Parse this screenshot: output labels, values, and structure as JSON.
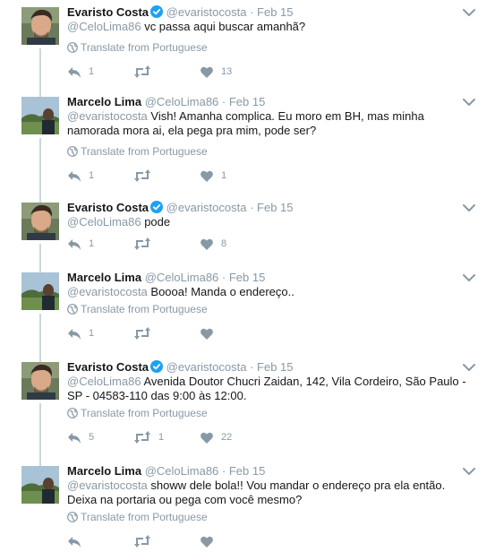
{
  "translate_label": "Translate from Portuguese",
  "colors": {
    "muted": "#8899a6",
    "verified": "#1da1f2",
    "line": "#ccd6dd"
  },
  "icons": [
    "verified-badge-icon",
    "reply-icon",
    "retweet-icon",
    "like-icon",
    "globe-icon",
    "chevron-down-icon"
  ],
  "tweets": [
    {
      "name": "Evaristo Costa",
      "verified": true,
      "handle": "@evaristocosta",
      "dot": "·",
      "time": "Feb 15",
      "mention": "@CeloLima86",
      "text": " vc passa aqui buscar amanhã?",
      "translate": true,
      "replies": "1",
      "retweets": "",
      "likes": "13"
    },
    {
      "name": "Marcelo Lima",
      "verified": false,
      "handle": "@CeloLima86",
      "dot": "·",
      "time": "Feb 15",
      "mention": "@evaristocosta",
      "text": " Vish! Amanha complica. Eu moro em BH, mas minha namorada mora ai, ela pega pra mim, pode ser?",
      "translate": true,
      "replies": "1",
      "retweets": "",
      "likes": "1"
    },
    {
      "name": "Evaristo Costa",
      "verified": true,
      "handle": "@evaristocosta",
      "dot": "·",
      "time": "Feb 15",
      "mention": "@CeloLima86",
      "text": " pode",
      "translate": false,
      "replies": "1",
      "retweets": "",
      "likes": "8"
    },
    {
      "name": "Marcelo Lima",
      "verified": false,
      "handle": "@CeloLima86",
      "dot": "·",
      "time": "Feb 15",
      "mention": "@evaristocosta",
      "text": " Boooa! Manda o endereço..",
      "translate": true,
      "replies": "1",
      "retweets": "",
      "likes": ""
    },
    {
      "name": "Evaristo Costa",
      "verified": true,
      "handle": "@evaristocosta",
      "dot": "·",
      "time": "Feb 15",
      "mention": "@CeloLima86",
      "text": " Avenida Doutor Chucri Zaidan, 142, Vila Cordeiro, São Paulo - SP - 04583-110 das 9:00 às 12:00.",
      "translate": true,
      "replies": "5",
      "retweets": "1",
      "likes": "22"
    },
    {
      "name": "Marcelo Lima",
      "verified": false,
      "handle": "@CeloLima86",
      "dot": "·",
      "time": "Feb 15",
      "mention": "@evaristocosta",
      "text": " showw dele bola!! Vou mandar o endereço pra ela então. Deixa na portaria ou pega com você mesmo?",
      "translate": true,
      "replies": "",
      "retweets": "",
      "likes": ""
    }
  ]
}
